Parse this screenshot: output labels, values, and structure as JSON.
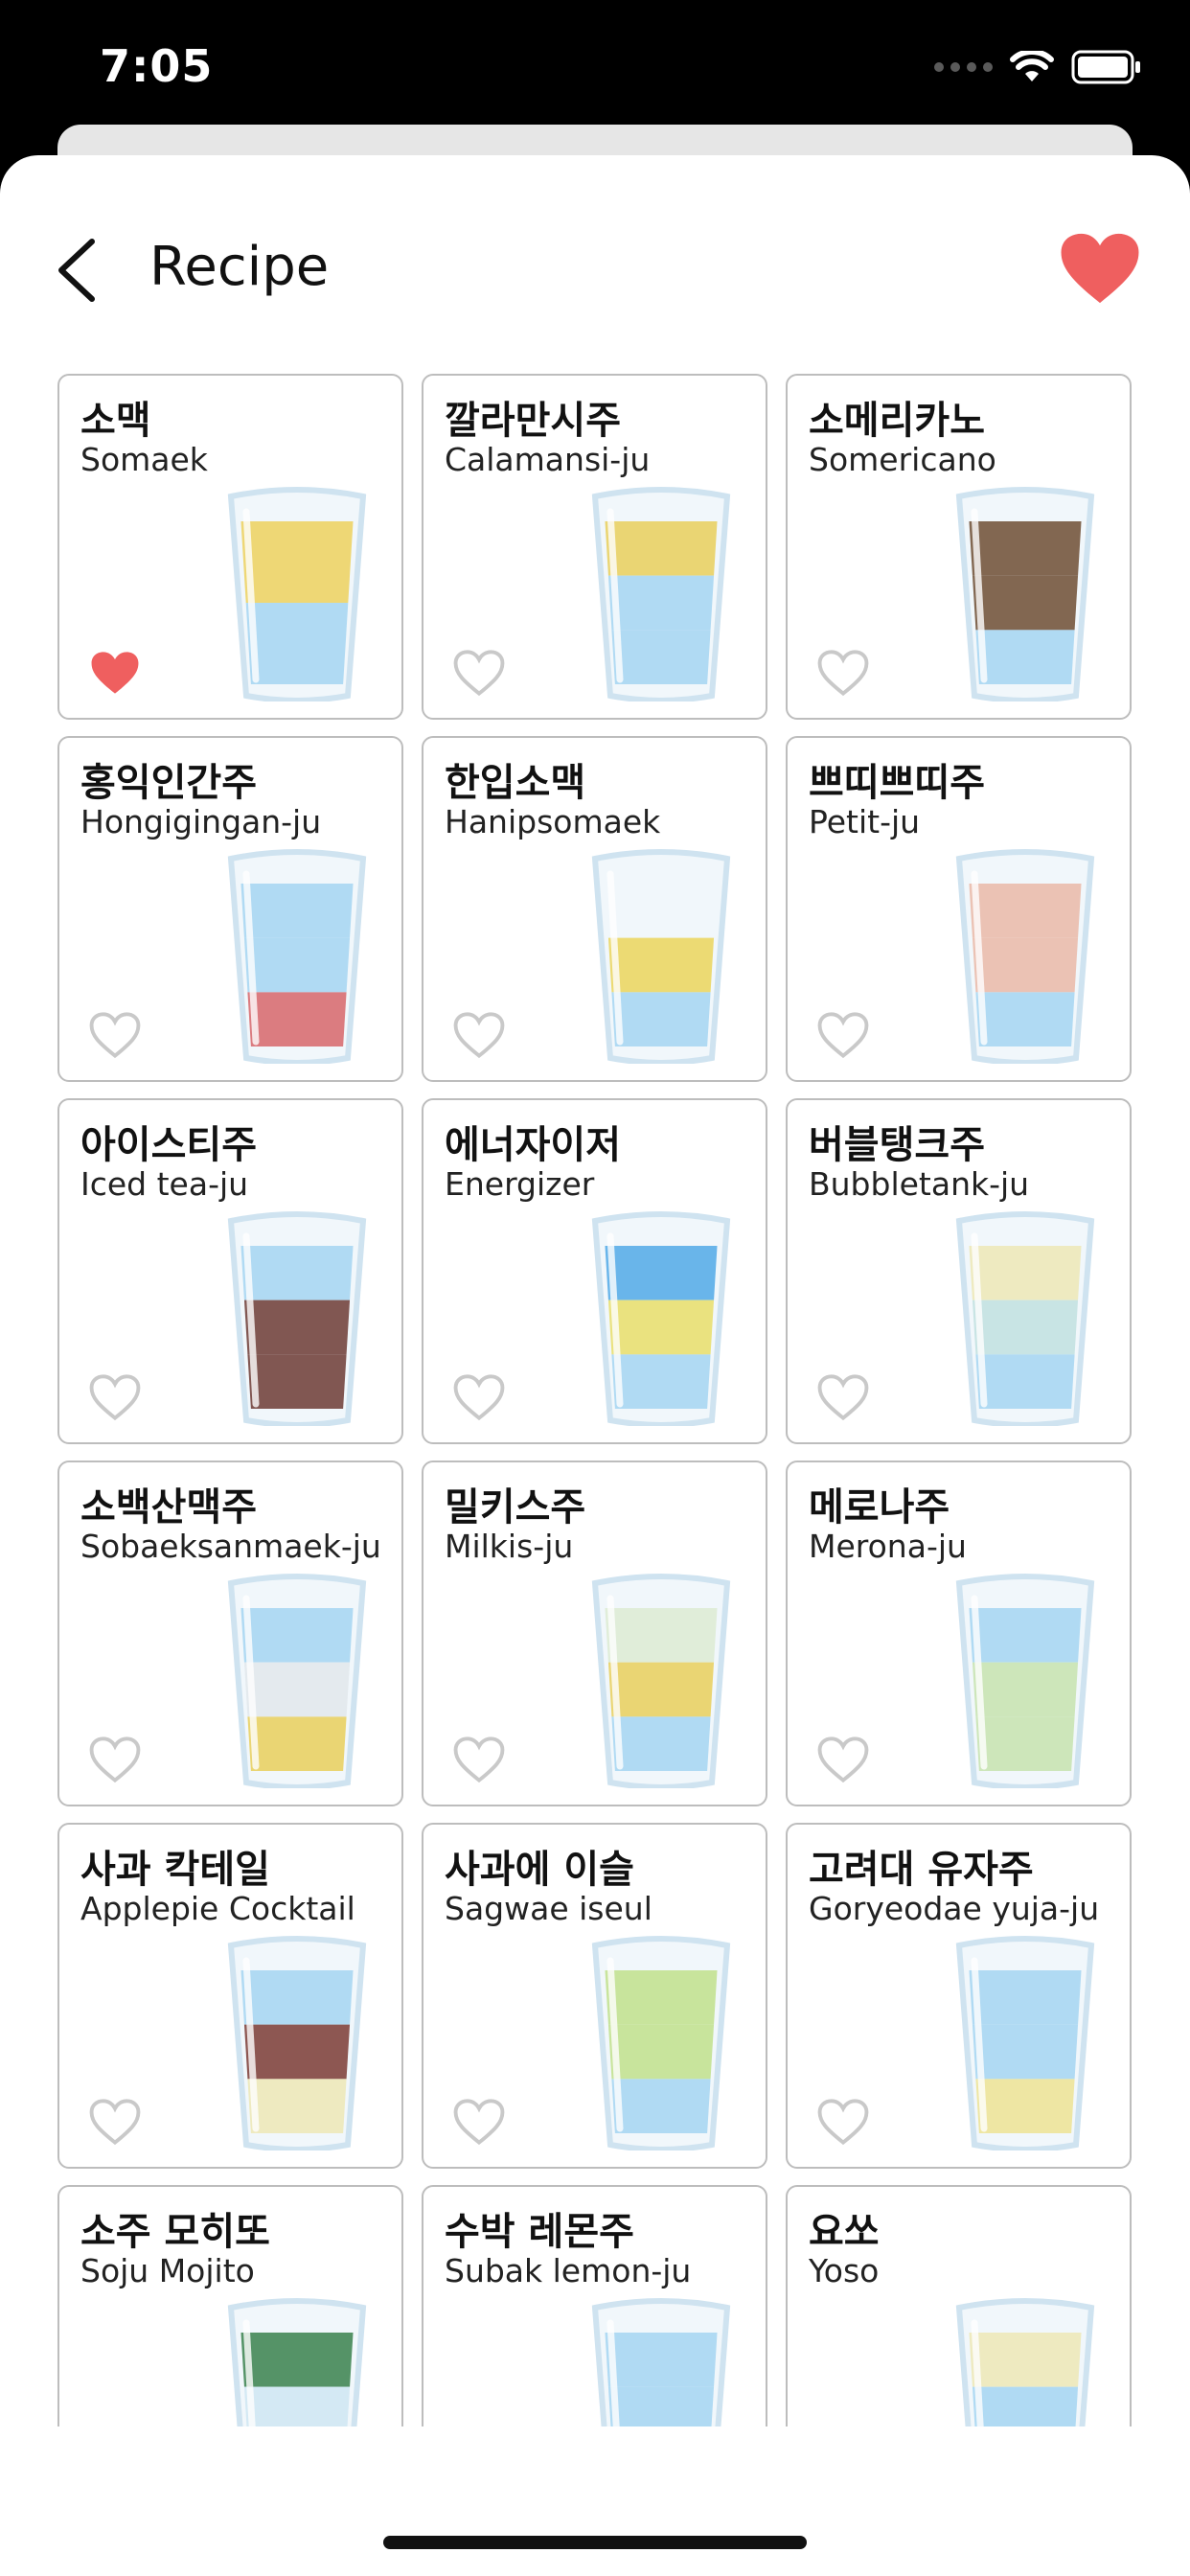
{
  "status_bar": {
    "time": "7:05"
  },
  "nav": {
    "title": "Recipe"
  },
  "colors": {
    "heart": "#ef5f5f",
    "heart_outline": "#c9c9c9",
    "border": "#bdbdbd"
  },
  "recipes": [
    {
      "korean": "소맥",
      "english": "Somaek",
      "favorite": true,
      "layers": [
        "#fbd54c",
        "#a8d8f4"
      ]
    },
    {
      "korean": "깔라만시주",
      "english": "Calamansi-ju",
      "favorite": false,
      "layers": [
        "#f6d24a",
        "#a8d8f4",
        "#a8d8f4"
      ]
    },
    {
      "korean": "소메리카노",
      "english": "Somericano",
      "favorite": false,
      "layers": [
        "#6b3f1d",
        "#6b3f1d",
        "#a8d8f4"
      ]
    },
    {
      "korean": "홍익인간주",
      "english": "Hongigingan-ju",
      "favorite": false,
      "layers": [
        "#a8d8f4",
        "#a8d8f4",
        "#e25b5b"
      ]
    },
    {
      "korean": "한입소맥",
      "english": "Hanipsomaek",
      "favorite": false,
      "layers": [
        "#ffffff",
        "#f8d84a",
        "#a8d8f4"
      ]
    },
    {
      "korean": "쁘띠쁘띠주",
      "english": "Petit-ju",
      "favorite": false,
      "layers": [
        "#f7b9a0",
        "#f7b9a0",
        "#a8d8f4"
      ]
    },
    {
      "korean": "아이스티주",
      "english": "Iced tea-ju",
      "favorite": false,
      "layers": [
        "#a8d8f4",
        "#6a2a1e",
        "#6a2a1e"
      ]
    },
    {
      "korean": "에너자이저",
      "english": "Energizer",
      "favorite": false,
      "layers": [
        "#4aa7e8",
        "#f6e35a",
        "#a8d8f4"
      ]
    },
    {
      "korean": "버블탱크주",
      "english": "Bubbletank-ju",
      "favorite": false,
      "layers": [
        "#fbeeb0",
        "#c9e6e0",
        "#a8d8f4"
      ]
    },
    {
      "korean": "소백산맥주",
      "english": "Sobaeksanmaek-ju",
      "favorite": false,
      "layers": [
        "#a8d8f4",
        "#eeeeee",
        "#f6d24a"
      ]
    },
    {
      "korean": "밀키스주",
      "english": "Milkis-ju",
      "favorite": false,
      "layers": [
        "#e9f2d2",
        "#f6d24a",
        "#a8d8f4"
      ]
    },
    {
      "korean": "메로나주",
      "english": "Merona-ju",
      "favorite": false,
      "layers": [
        "#a8d8f4",
        "#cfe9a8",
        "#cfe9a8"
      ]
    },
    {
      "korean": "사과 칵테일",
      "english": "Applepie Cocktail",
      "favorite": false,
      "layers": [
        "#a8d8f4",
        "#7a2a1e",
        "#fbeeb0"
      ]
    },
    {
      "korean": "사과에 이슬",
      "english": "Sagwae iseul",
      "favorite": false,
      "layers": [
        "#c8e680",
        "#c8e680",
        "#a8d8f4"
      ]
    },
    {
      "korean": "고려대 유자주",
      "english": "Goryeodae yuja-ju",
      "favorite": false,
      "layers": [
        "#a8d8f4",
        "#a8d8f4",
        "#fbe98a"
      ]
    },
    {
      "korean": "소주 모히또",
      "english": "Soju Mojito",
      "favorite": false,
      "layers": [
        "#2f7a3a",
        "#d8ecf6",
        "#d8ecf6"
      ]
    },
    {
      "korean": "수박 레몬주",
      "english": "Subak lemon-ju",
      "favorite": false,
      "layers": [
        "#a8d8f4",
        "#a8d8f4",
        "#a8d8f4"
      ]
    },
    {
      "korean": "요쏘",
      "english": "Yoso",
      "favorite": false,
      "layers": [
        "#fbeeb0",
        "#a8d8f4",
        "#a8d8f4"
      ]
    }
  ]
}
